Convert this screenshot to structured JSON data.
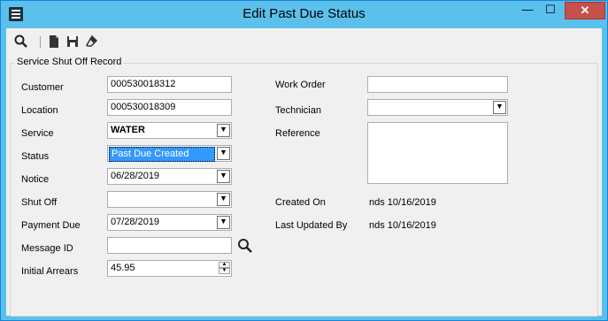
{
  "window": {
    "title": "Edit Past Due Status",
    "minimize_glyph": "—",
    "maximize_glyph": "☐",
    "close_glyph": "✕"
  },
  "toolbar": {
    "icons": [
      "search-icon",
      "new-document-icon",
      "save-icon",
      "eraser-icon"
    ]
  },
  "group": {
    "title": "Service Shut Off Record"
  },
  "form": {
    "customer": {
      "label": "Customer",
      "value": "000530018312"
    },
    "location": {
      "label": "Location",
      "value": "000530018309"
    },
    "service": {
      "label": "Service",
      "value": "WATER"
    },
    "status": {
      "label": "Status",
      "value": "Past Due Created"
    },
    "notice": {
      "label": "Notice",
      "value": "06/28/2019"
    },
    "shut_off": {
      "label": "Shut Off",
      "value": ""
    },
    "payment_due": {
      "label": "Payment Due",
      "value": "07/28/2019"
    },
    "message_id": {
      "label": "Message ID",
      "value": ""
    },
    "initial_arrears": {
      "label": "Initial Arrears",
      "value": "45.95"
    },
    "work_order": {
      "label": "Work Order",
      "value": ""
    },
    "technician": {
      "label": "Technician",
      "value": ""
    },
    "reference": {
      "label": "Reference",
      "value": ""
    },
    "created_on": {
      "label": "Created On",
      "value": "nds 10/16/2019"
    },
    "last_updated_by": {
      "label": "Last Updated By",
      "value": "nds 10/16/2019"
    }
  },
  "colors": {
    "titlebar": "#5bc0ec",
    "close_button": "#c7504a",
    "selection": "#3399ff"
  }
}
